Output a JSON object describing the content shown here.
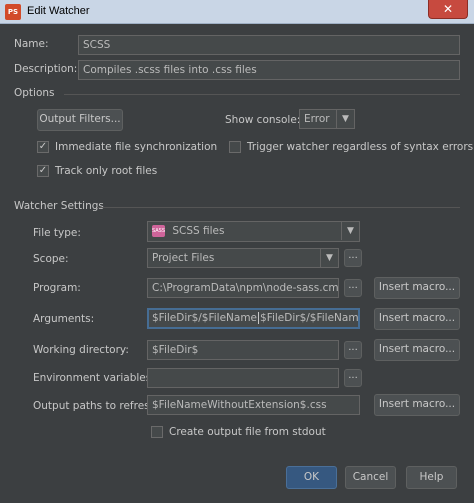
{
  "window": {
    "title": "Edit Watcher",
    "app_icon_text": "PS",
    "close_symbol": "✕"
  },
  "name": {
    "label": "Name:",
    "value": "SCSS"
  },
  "description": {
    "label": "Description:",
    "value": "Compiles .scss files into .css files"
  },
  "options": {
    "title": "Options",
    "output_filters_button": "Output Filters...",
    "show_console_label": "Show console:",
    "show_console_value": "Error",
    "immediate_sync": {
      "label": "Immediate file synchronization",
      "checked": true
    },
    "trigger_watcher": {
      "label": "Trigger watcher regardless of syntax errors",
      "checked": false
    },
    "track_root": {
      "label": "Track only root files",
      "checked": true
    }
  },
  "watcher": {
    "title": "Watcher Settings",
    "file_type": {
      "label": "File type:",
      "value": "SCSS files",
      "icon_text": "SASS"
    },
    "scope": {
      "label": "Scope:",
      "value": "Project Files"
    },
    "program": {
      "label": "Program:",
      "value": "C:\\ProgramData\\npm\\node-sass.cmd"
    },
    "arguments": {
      "label": "Arguments:",
      "value_before_cursor": "$FileDir$/$FileName",
      "value_after_cursor": "$FileDir$/$FileNameWith"
    },
    "working_dir": {
      "label": "Working directory:",
      "value": "$FileDir$"
    },
    "env_vars": {
      "label": "Environment variables:",
      "value": ""
    },
    "output_paths": {
      "label": "Output paths to refresh:",
      "value": "$FileNameWithoutExtension$.css"
    },
    "create_output": {
      "label": "Create output file from stdout",
      "checked": false
    },
    "browse_label": "...",
    "insert_macro_label": "Insert macro..."
  },
  "footer": {
    "ok": "OK",
    "cancel": "Cancel",
    "help": "Help"
  },
  "colors": {
    "background": "#3c3f41",
    "field": "#45494a",
    "focus_border": "#466d94",
    "primary_button": "#365880"
  }
}
